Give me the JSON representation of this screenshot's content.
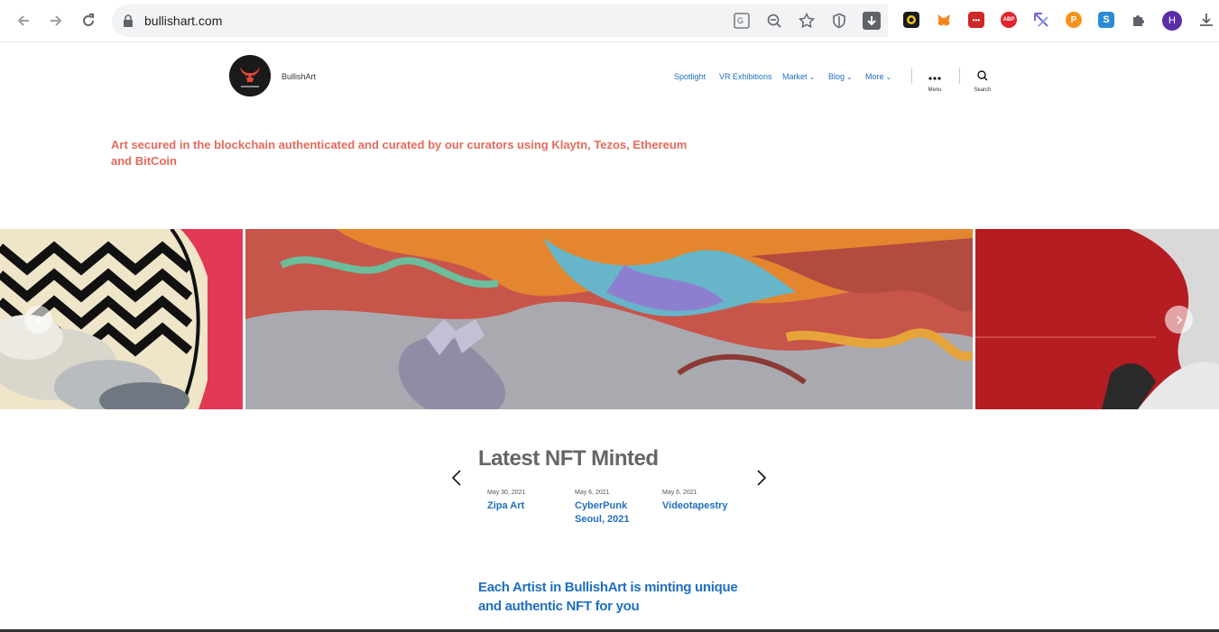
{
  "browser": {
    "url": "bullishart.com",
    "profile_initial": "H",
    "extensions": [
      {
        "name": "ext-1",
        "color": "#1b1b1b",
        "text": ""
      },
      {
        "name": "metamask",
        "color": "#f5a623",
        "text": ""
      },
      {
        "name": "lastpass",
        "color": "#cc2929",
        "text": "•••"
      },
      {
        "name": "adblock-plus",
        "color": "#e0262f",
        "text": "ABP"
      },
      {
        "name": "ext-5",
        "color": "#6b6bd6",
        "text": ""
      },
      {
        "name": "ext-6",
        "color": "#f7931a",
        "text": "P"
      },
      {
        "name": "ext-7",
        "color": "#2b8ad6",
        "text": "S"
      }
    ]
  },
  "site": {
    "name": "BullishArt",
    "nav": [
      {
        "label": "Spotlight",
        "dropdown": false
      },
      {
        "label": "VR Exhibitions",
        "dropdown": false
      },
      {
        "label": "Market",
        "dropdown": true
      },
      {
        "label": "Blog",
        "dropdown": true
      },
      {
        "label": "More",
        "dropdown": true
      }
    ],
    "menu_label": "Menu",
    "search_label": "Search",
    "tagline": "Art secured in the blockchain authenticated and curated by our curators using Klaytn, Tezos, Ethereum and BitCoin"
  },
  "latest": {
    "title": "Latest NFT Minted",
    "items": [
      {
        "date": "May 30, 2021",
        "name": "Zipa Art"
      },
      {
        "date": "May 6, 2021",
        "name": "CyberPunk Seoul, 2021"
      },
      {
        "date": "May 6, 2021",
        "name": "Videotapestry"
      }
    ]
  },
  "artist_heading": "Each Artist in BullishArt is minting unique and authentic NFT for you"
}
